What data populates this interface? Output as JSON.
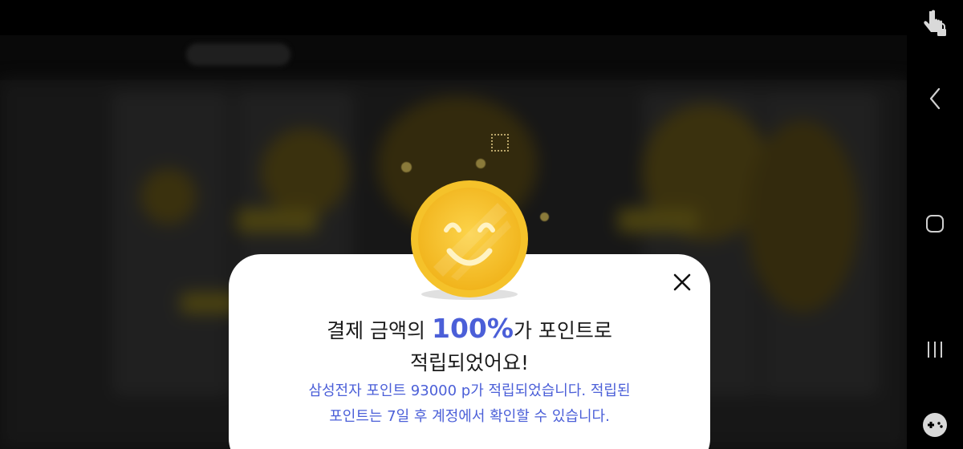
{
  "popup": {
    "headline_before": "결제 금액의 ",
    "headline_highlight": "100%",
    "headline_after": "가 포인트로",
    "headline_line2": "적립되었어요!",
    "sub_line1": "삼성전자 포인트 93000 p가 적립되었습니다. 적립된",
    "sub_line2": "포인트는 7일 후 계정에서 확인할 수 있습니다.",
    "close_icon": "close-icon",
    "coin_icon": "smiley-coin-icon"
  },
  "navbar": {
    "icons": [
      "touch-lock-icon",
      "back-icon",
      "home-icon",
      "recent-apps-icon",
      "game-controller-icon"
    ]
  },
  "colors": {
    "accent": "#4b5fd8",
    "coin": "#f7c62c",
    "dialog_bg": "#ffffff"
  }
}
